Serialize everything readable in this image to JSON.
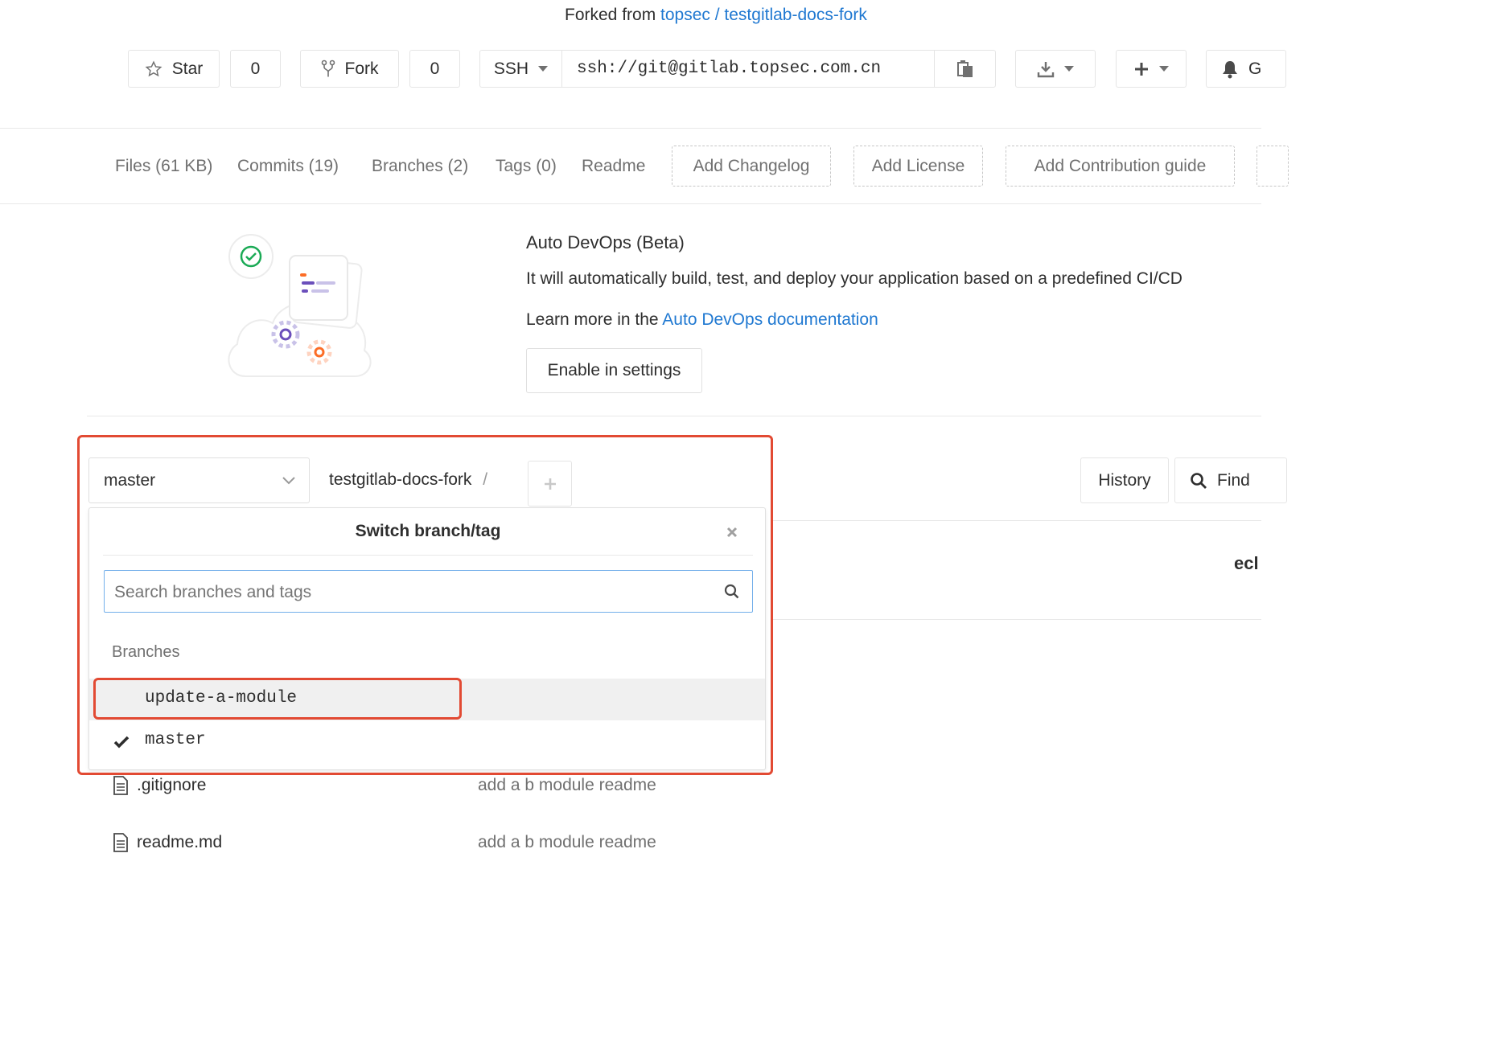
{
  "header": {
    "forked_prefix": "Forked from",
    "forked_link": "topsec / testgitlab-docs-fork"
  },
  "actions": {
    "star_label": "Star",
    "star_count": "0",
    "fork_label": "Fork",
    "fork_count": "0",
    "protocol": "SSH",
    "clone_url": "ssh://git@gitlab.topsec.com.cn",
    "notification_partial": "G"
  },
  "nav": {
    "files": "Files (61 KB)",
    "commits": "Commits (19)",
    "branches": "Branches (2)",
    "tags": "Tags (0)",
    "readme": "Readme",
    "add_changelog": "Add Changelog",
    "add_license": "Add License",
    "add_contribution": "Add Contribution guide"
  },
  "autodevops": {
    "title": "Auto DevOps (Beta)",
    "description": "It will automatically build, test, and deploy your application based on a predefined CI/CD",
    "learn_prefix": "Learn more in the",
    "learn_link": "Auto DevOps documentation",
    "enable_button": "Enable in settings"
  },
  "repo_bar": {
    "branch_selected": "master",
    "path_root": "testgitlab-docs-fork",
    "path_sep": "/",
    "history_button": "History",
    "find_button": "Find",
    "partial_text": "ecl"
  },
  "branch_dropdown": {
    "title": "Switch branch/tag",
    "search_placeholder": "Search branches and tags",
    "section_label": "Branches",
    "branches": [
      "update-a-module",
      "master"
    ]
  },
  "files": [
    {
      "name": ".gitignore",
      "commit": "add a b module readme"
    },
    {
      "name": "readme.md",
      "commit": "add a b module readme"
    }
  ],
  "colors": {
    "link": "#1f78d1",
    "highlight_border": "#e24a33",
    "selected_row_bg": "#f0f0f0",
    "search_border": "#73afea"
  }
}
